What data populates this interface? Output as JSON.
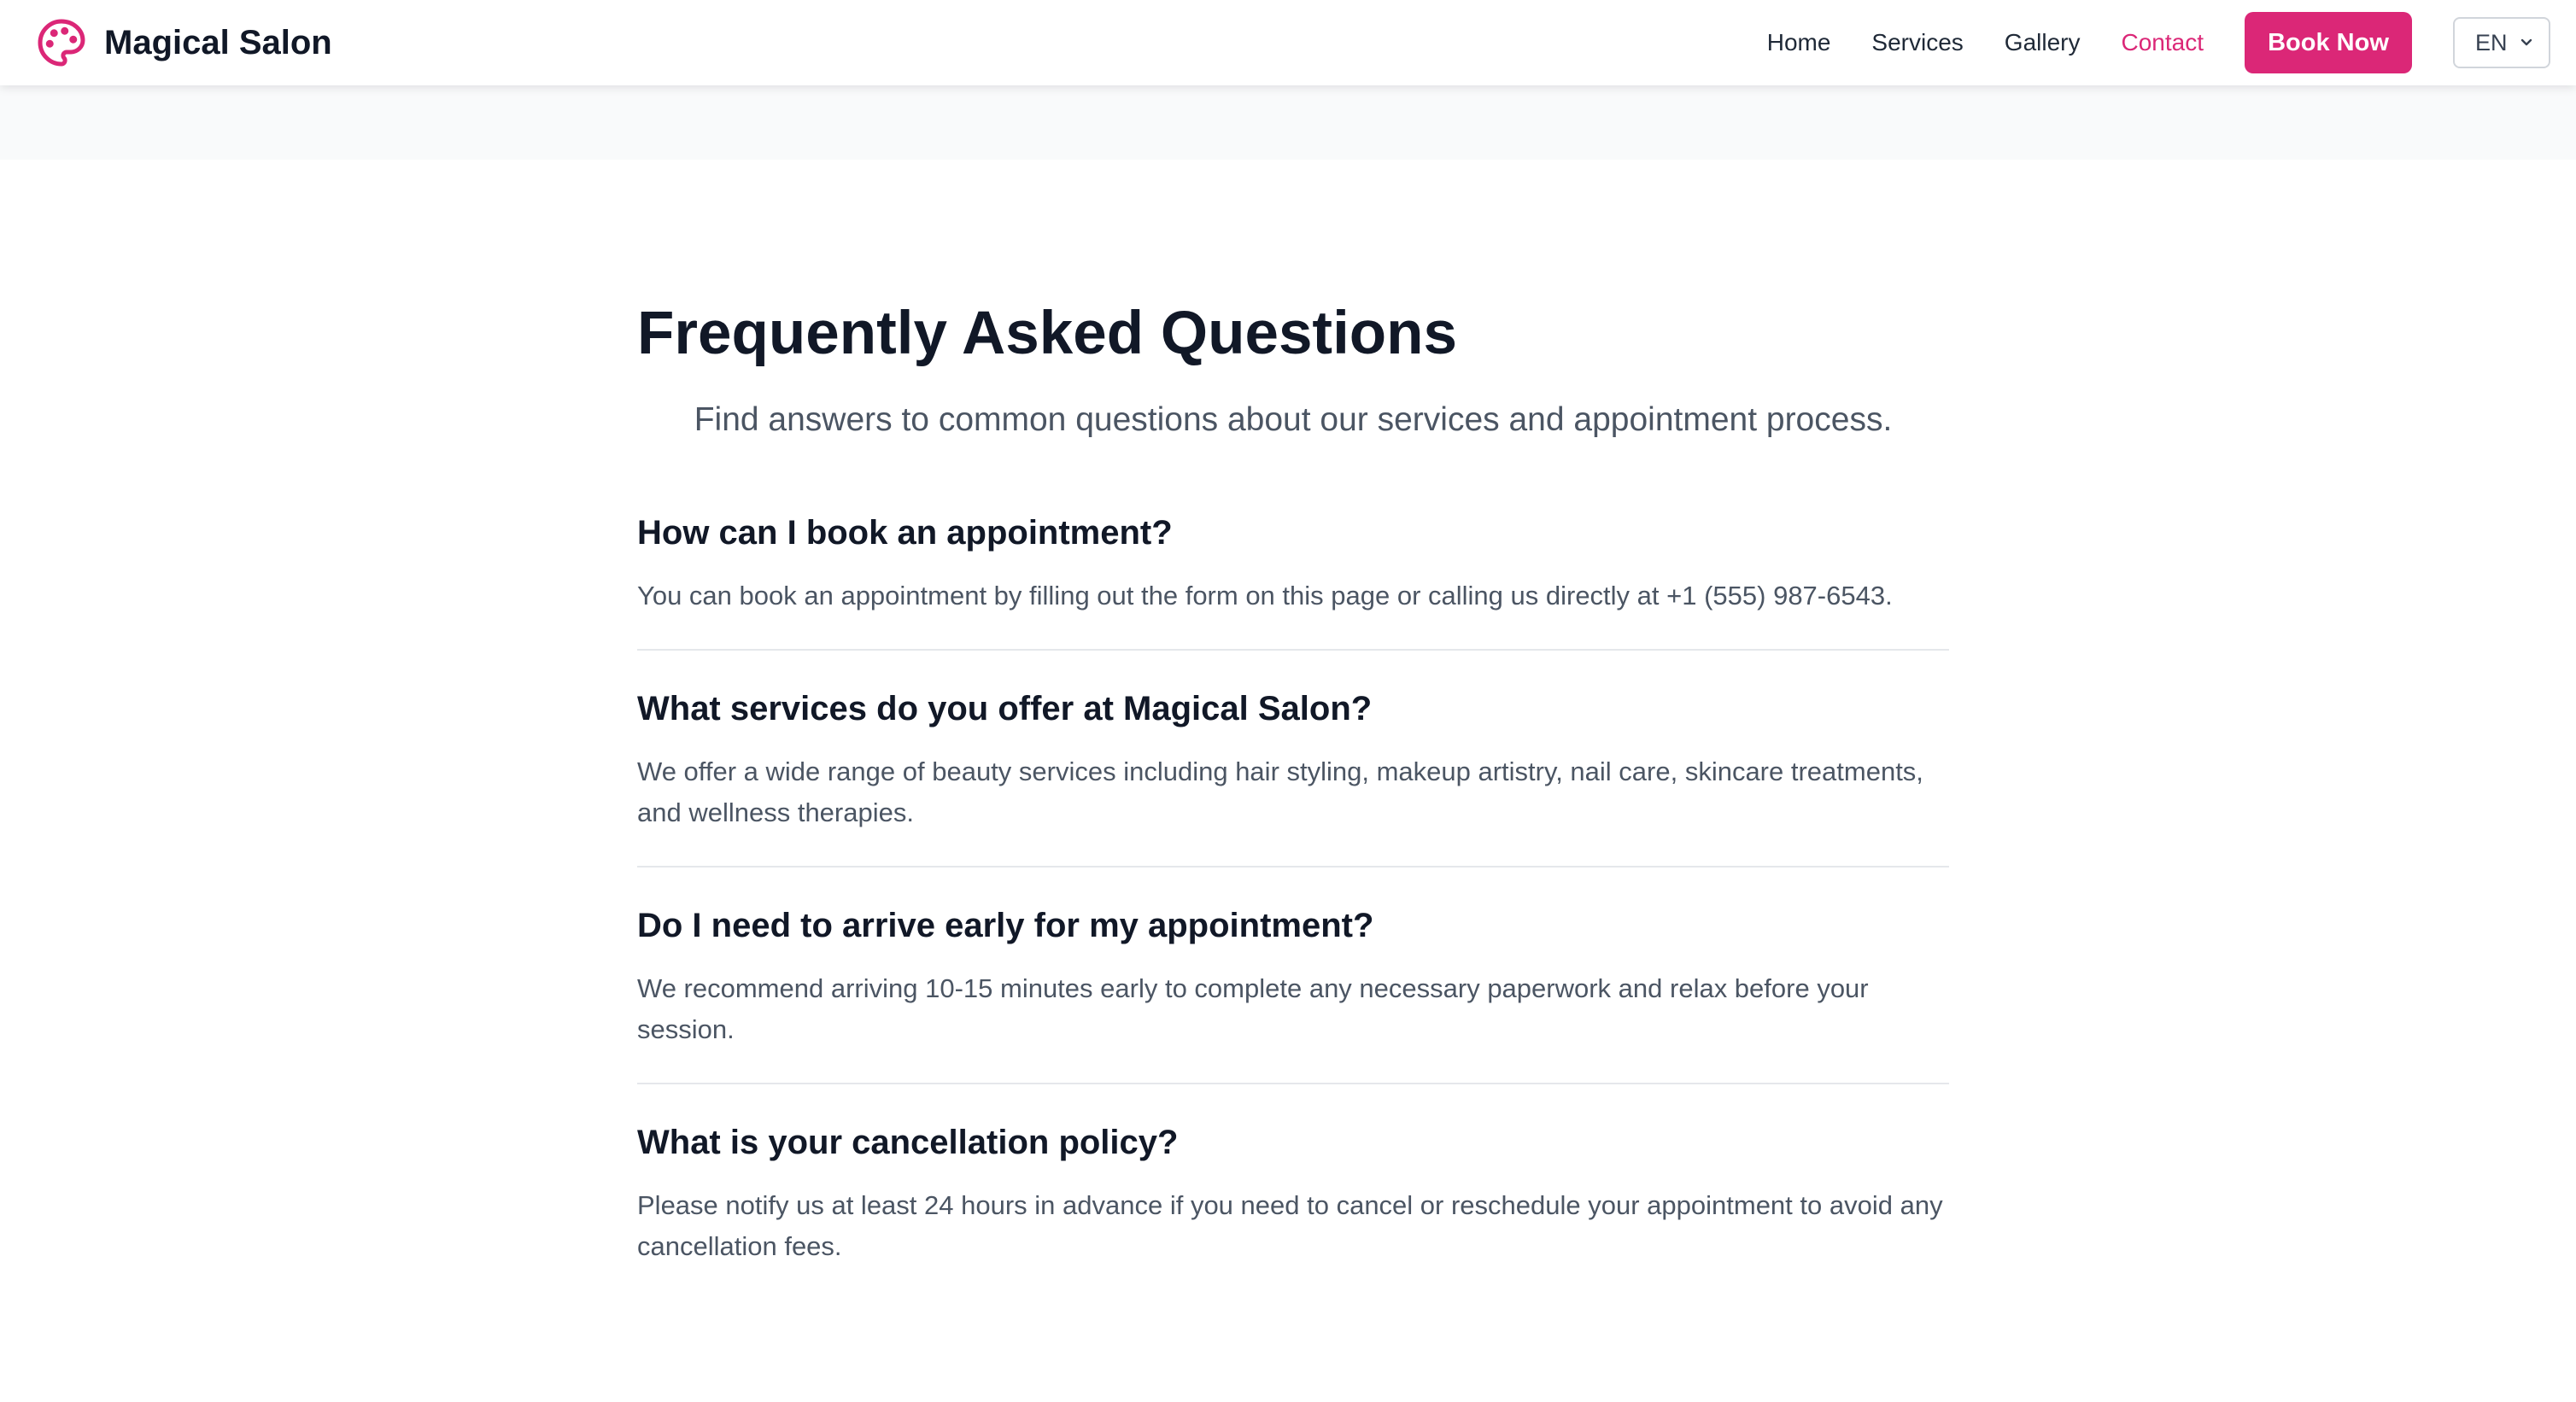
{
  "header": {
    "brand": "Magical Salon",
    "nav": [
      {
        "label": "Home",
        "active": false
      },
      {
        "label": "Services",
        "active": false
      },
      {
        "label": "Gallery",
        "active": false
      },
      {
        "label": "Contact",
        "active": true
      }
    ],
    "cta_label": "Book Now",
    "language": "EN"
  },
  "faq": {
    "title": "Frequently Asked Questions",
    "subtitle": "Find answers to common questions about our services and appointment process.",
    "items": [
      {
        "question": "How can I book an appointment?",
        "answer": "You can book an appointment by filling out the form on this page or calling us directly at +1 (555) 987-6543."
      },
      {
        "question": "What services do you offer at Magical Salon?",
        "answer": "We offer a wide range of beauty services including hair styling, makeup artistry, nail care, skincare treatments, and wellness therapies."
      },
      {
        "question": "Do I need to arrive early for my appointment?",
        "answer": "We recommend arriving 10-15 minutes early to complete any necessary paperwork and relax before your session."
      },
      {
        "question": "What is your cancellation policy?",
        "answer": "Please notify us at least 24 hours in advance if you need to cancel or reschedule your appointment to avoid any cancellation fees."
      }
    ]
  },
  "colors": {
    "accent": "#db2777",
    "text_dark": "#111827",
    "text_muted": "#4b5563",
    "band": "#f9fafb",
    "divider": "#e5e7eb"
  },
  "icons": {
    "logo": "palette-icon",
    "language_dropdown": "chevron-down-icon"
  }
}
